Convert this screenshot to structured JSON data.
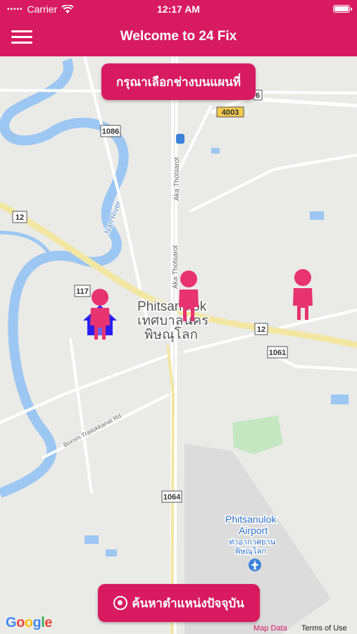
{
  "status_bar": {
    "carrier": "Carrier",
    "time": "12:17 AM"
  },
  "header": {
    "title": "Welcome to 24 Fix",
    "menu_icon": "hamburger-icon"
  },
  "map": {
    "top_button": "กรุณาเลือกช่างบนแผนที่",
    "bottom_button": "ค้นหาตำแหน่งปัจจุบัน",
    "labels": {
      "city_en": "Phitsanulok",
      "city_th1": "เทศบาลนคร",
      "city_th2": "พิษณุโลก",
      "airport_en1": "Phitsanulok",
      "airport_en2": "Airport",
      "airport_th1": "ท่าอากาศยาน",
      "airport_th2": "พิษณุโลก",
      "river": "Nan River",
      "road_aka1": "Aka Thotsarot",
      "road_aka2": "Aka Thotsarot",
      "road_borom": "Borom Trailokkanat Rd"
    },
    "route_shields": [
      "1086",
      "4003",
      "12",
      "117",
      "12",
      "1061",
      "1064",
      "6"
    ],
    "technician_markers": 3,
    "attribution": {
      "google": "Google",
      "map_data": "Map Data",
      "terms": "Terms of Use"
    },
    "colors": {
      "accent": "#d81b60",
      "marker": "#e7336f",
      "home": "#2b1df0",
      "water": "#9cc7f2"
    }
  }
}
